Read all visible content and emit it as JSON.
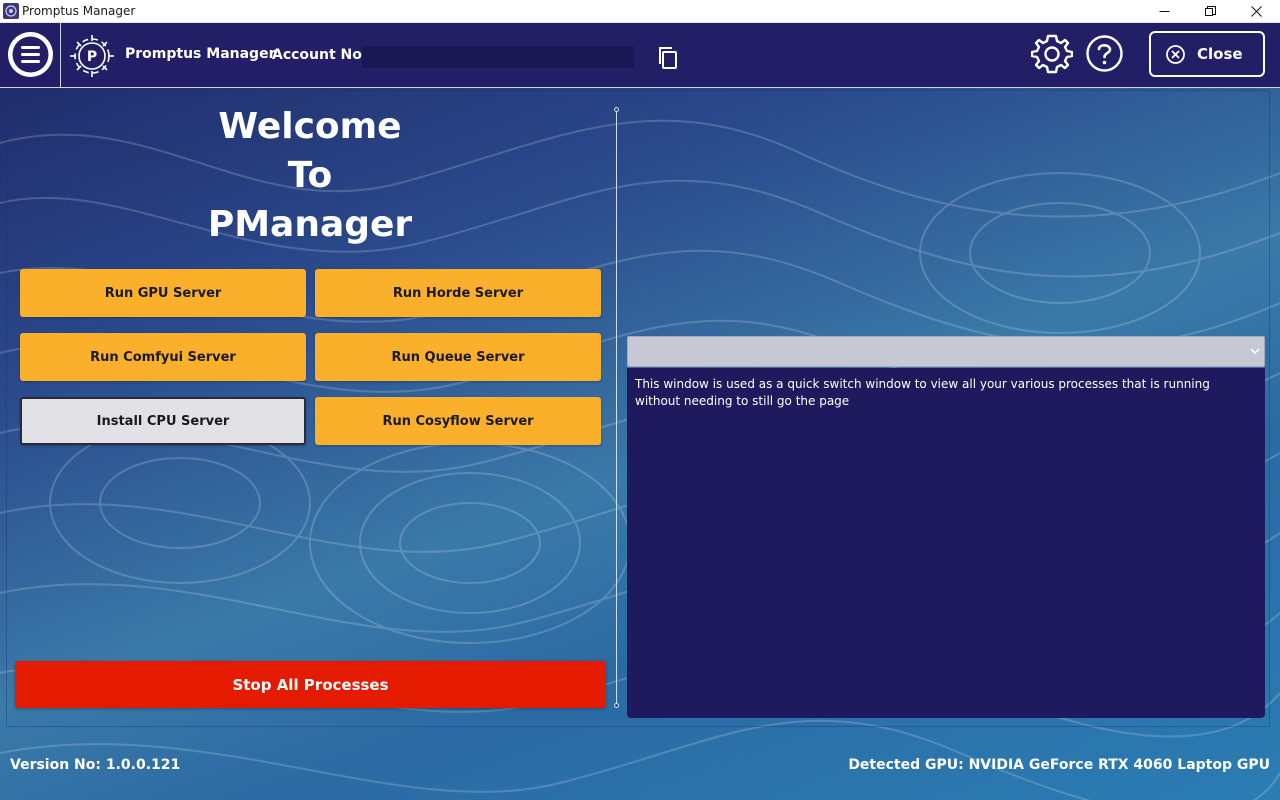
{
  "window": {
    "title": "Promptus Manager"
  },
  "header": {
    "app_name": "Promptus Manager",
    "account_label": "Account No:",
    "account_value": "",
    "close_label": "Close"
  },
  "welcome": {
    "line1": "Welcome",
    "line2": "To",
    "line3": "PManager"
  },
  "actions": {
    "run_gpu": "Run GPU Server",
    "run_horde": "Run Horde Server",
    "run_comfyui": "Run Comfyui Server",
    "run_queue": "Run Queue Server",
    "install_cpu": "Install CPU Server",
    "run_cosyflow": "Run Cosyflow Server",
    "stop_all": "Stop All Processes"
  },
  "process_switcher": {
    "selected": "",
    "description": "This window is used as a quick switch window to view all your various processes that is running without needing to still go the page"
  },
  "footer": {
    "version": "Version No: 1.0.0.121",
    "gpu": "Detected GPU: NVIDIA GeForce RTX 4060 Laptop GPU"
  },
  "colors": {
    "header_bg": "#221f66",
    "button_yellow": "#fbb02b",
    "stop_red": "#e51b00",
    "console_bg": "#1f1a5e"
  }
}
